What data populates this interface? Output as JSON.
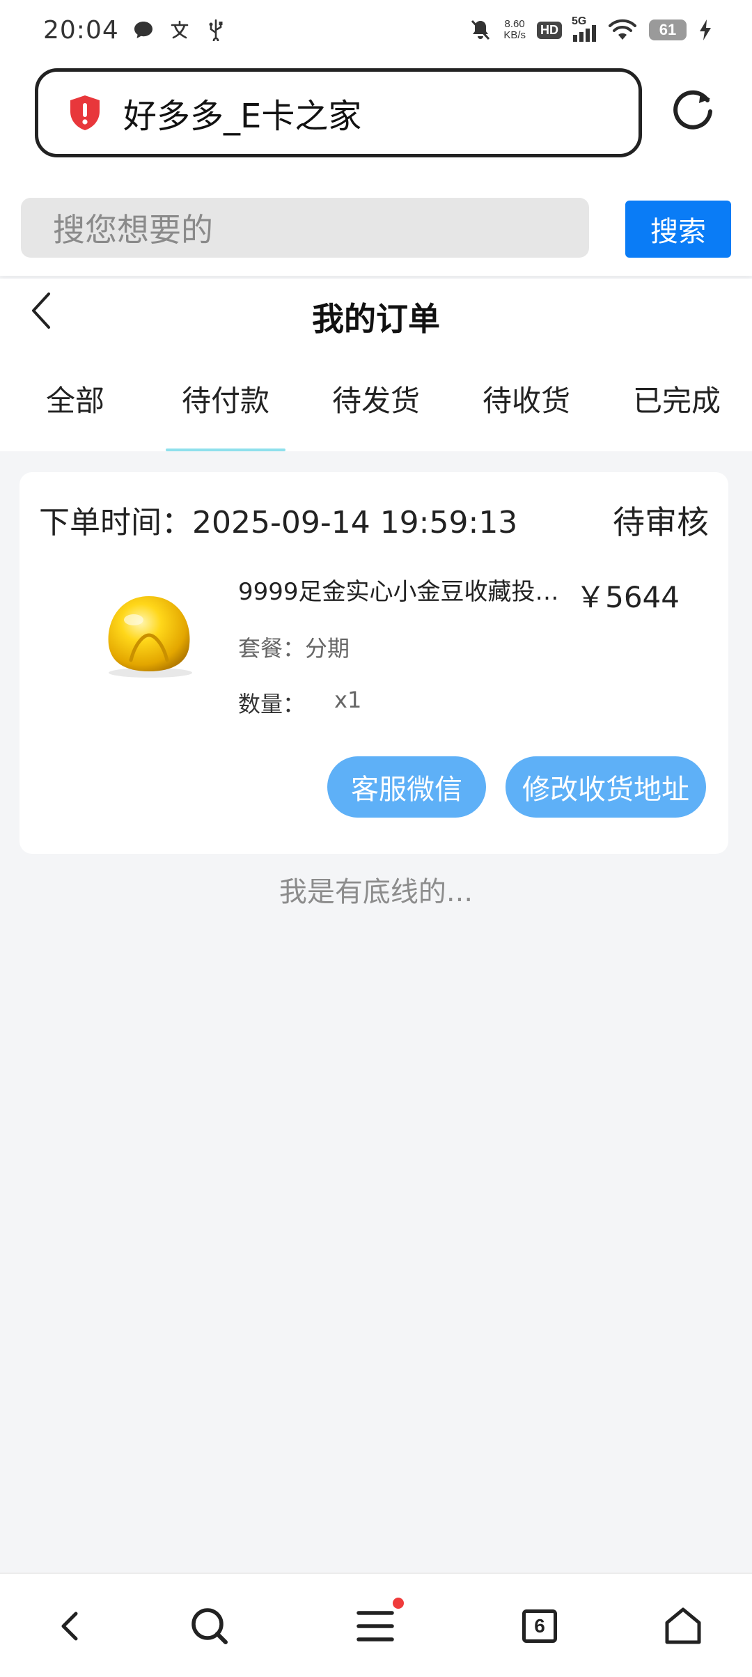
{
  "status_bar": {
    "time": "20:04",
    "net_speed_value": "8.60",
    "net_speed_unit": "KB/s",
    "hd": "HD",
    "network": "5G",
    "battery": "61",
    "icons": [
      "message-icon",
      "alipay-icon",
      "usb-icon",
      "mute-bell-icon",
      "signal-icon",
      "wifi-icon",
      "charging-icon"
    ]
  },
  "browser": {
    "site_title": "好多多_E卡之家"
  },
  "search": {
    "placeholder": "搜您想要的",
    "button_label": "搜索"
  },
  "header": {
    "title": "我的订单"
  },
  "tabs": [
    {
      "label": "全部",
      "active": false
    },
    {
      "label": "待付款",
      "active": true
    },
    {
      "label": "待发货",
      "active": false
    },
    {
      "label": "待收货",
      "active": false
    },
    {
      "label": "已完成",
      "active": false
    }
  ],
  "order": {
    "time_label": "下单时间：2025-09-14 19:59:13",
    "status": "待审核",
    "product_name": "9999足金实心小金豆收藏投资…",
    "price": "￥5644",
    "package_label": "套餐：分期",
    "quantity_label": "数量：",
    "quantity_value": "x1",
    "buttons": {
      "service": "客服微信",
      "address": "修改收货地址"
    }
  },
  "footer_note": "我是有底线的...",
  "bottom_nav": {
    "tabs_count": "6"
  },
  "colors": {
    "accent_blue": "#0a7cf6",
    "pill_blue": "#5eb0f7",
    "tab_indicator": "#8ee0ec",
    "shield_red": "#e8373b",
    "gold": "#f2c300"
  }
}
